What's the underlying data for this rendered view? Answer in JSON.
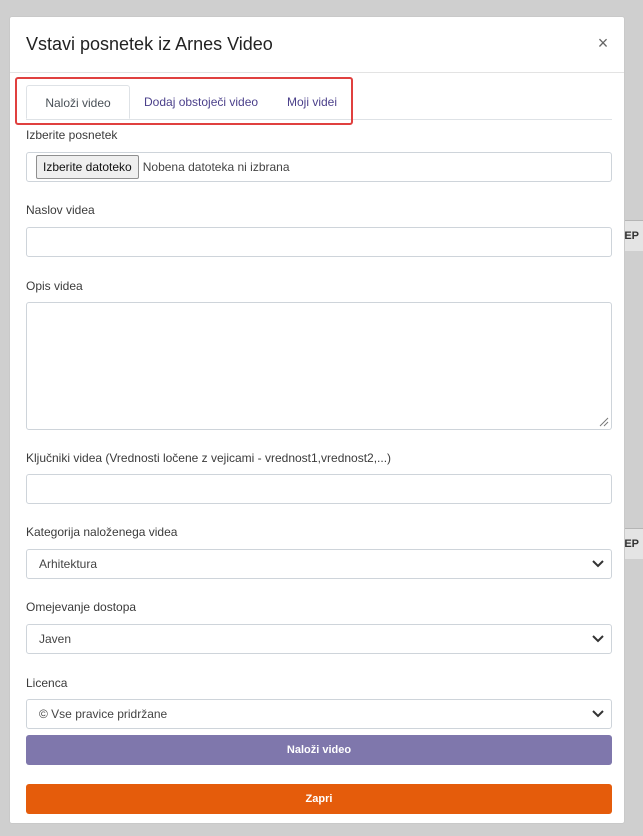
{
  "modal": {
    "title": "Vstavi posnetek iz Arnes Video",
    "close_icon": "close-icon",
    "close_glyph": "×"
  },
  "tabs": [
    {
      "label": "Naloži video",
      "active": true
    },
    {
      "label": "Dodaj obstoječi video",
      "active": false
    },
    {
      "label": "Moji videi",
      "active": false
    }
  ],
  "form": {
    "file_label": "Izberite posnetek",
    "file_button": "Izberite datoteko",
    "file_status": "Nobena datoteka ni izbrana",
    "title_label": "Naslov videa",
    "title_value": "",
    "description_label": "Opis videa",
    "description_value": "",
    "keywords_label": "Ključniki videa (Vrednosti ločene z vejicami - vrednost1,vrednost2,...)",
    "keywords_value": "",
    "category_label": "Kategorija naloženega videa",
    "category_value": "Arhitektura",
    "access_label": "Omejevanje dostopa",
    "access_value": "Javen",
    "license_label": "Licenca",
    "license_value": "© Vse pravice pridržane"
  },
  "buttons": {
    "upload": "Naloži video",
    "close": "Zapri"
  },
  "background": {
    "row_badge": "EP"
  },
  "colors": {
    "upload_button": "#7f77ac",
    "close_button": "#e55c0b",
    "highlight": "#e0403f",
    "tab_link": "#4a3f8a"
  }
}
